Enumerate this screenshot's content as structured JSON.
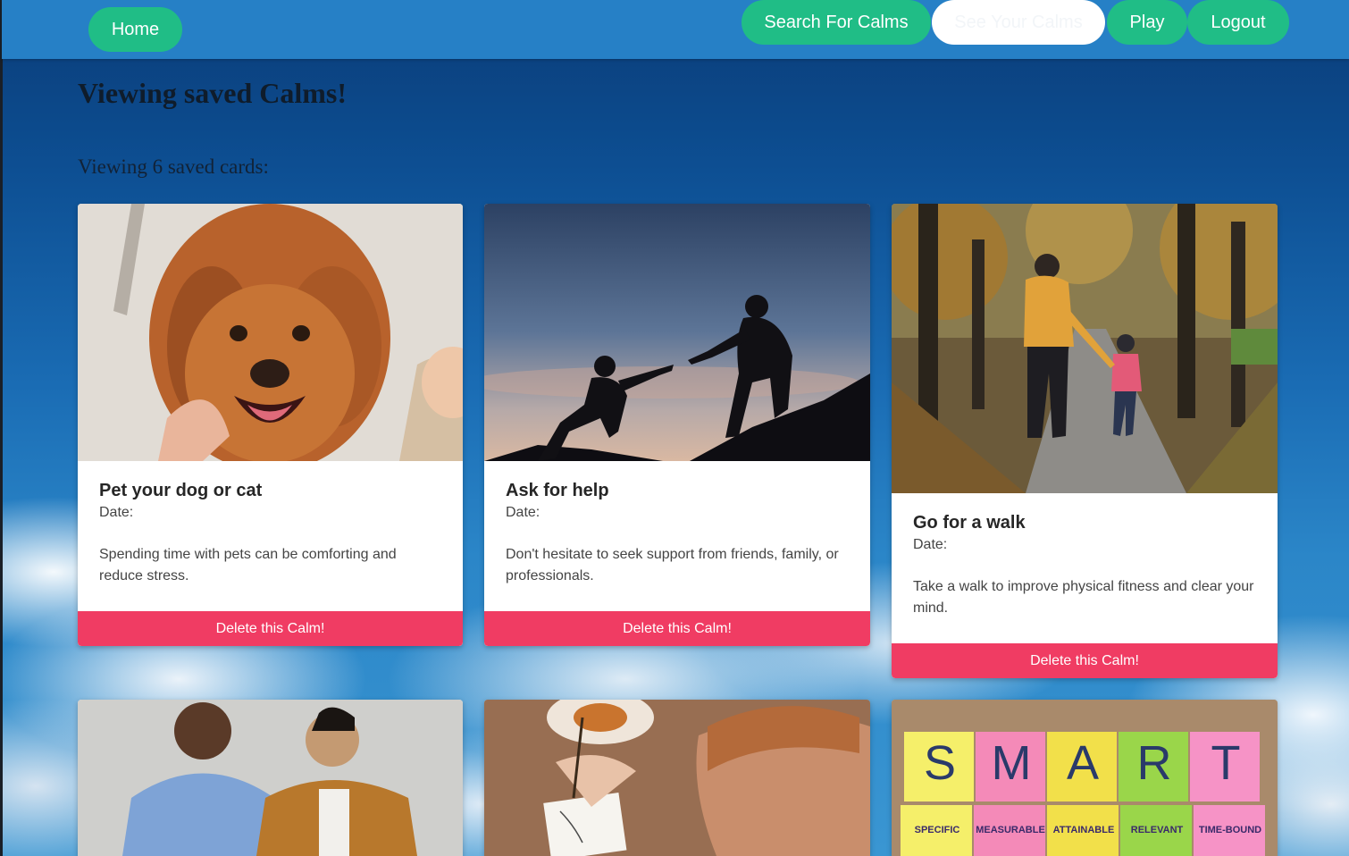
{
  "nav": {
    "home": "Home",
    "search": "Search For Calms",
    "saved": "See Your Calms",
    "play": "Play",
    "logout": "Logout"
  },
  "page": {
    "title": "Viewing saved Calms!",
    "count_text": "Viewing 6 saved cards:"
  },
  "cards": [
    {
      "title": "Pet your dog or cat",
      "date_label": "Date:",
      "description": "Spending time with pets can be comforting and reduce stress.",
      "delete_label": "Delete this Calm!"
    },
    {
      "title": "Ask for help",
      "date_label": "Date:",
      "description": "Don't hesitate to seek support from friends, family, or professionals.",
      "delete_label": "Delete this Calm!"
    },
    {
      "title": "Go for a walk",
      "date_label": "Date:",
      "description": "Take a walk to improve physical fitness and clear your mind.",
      "delete_label": "Delete this Calm!"
    }
  ],
  "smart_notes": {
    "letters": [
      "S",
      "M",
      "A",
      "R",
      "T"
    ],
    "words": [
      "SPECIFIC",
      "MEASURABLE",
      "ATTAINABLE",
      "RELEVANT",
      "TIME-BOUND"
    ]
  },
  "colors": {
    "nav_bar": "#2680c6",
    "nav_pill": "#20bd86",
    "delete_button": "#f03c63"
  }
}
